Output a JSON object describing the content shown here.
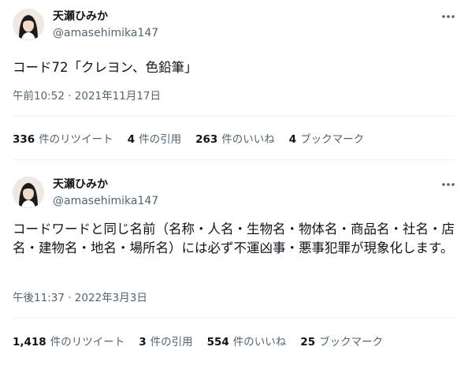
{
  "tweets": [
    {
      "author": {
        "name": "天瀬ひみか",
        "handle": "@amasehimika147"
      },
      "text": "コード72「クレヨン、色鉛筆」",
      "timestamp": "午前10:52 · 2021年11月17日",
      "stats": {
        "retweets": {
          "count": "336",
          "label": "件のリツイート"
        },
        "quotes": {
          "count": "4",
          "label": "件の引用"
        },
        "likes": {
          "count": "263",
          "label": "件のいいね"
        },
        "bookmarks": {
          "count": "4",
          "label": "ブックマーク"
        }
      }
    },
    {
      "author": {
        "name": "天瀬ひみか",
        "handle": "@amasehimika147"
      },
      "text": "コードワードと同じ名前（名称・人名・生物名・物体名・商品名・社名・店名・建物名・地名・場所名）には必ず不運凶事・悪事犯罪が現象化します。",
      "timestamp": "午後11:37 · 2022年3月3日",
      "stats": {
        "retweets": {
          "count": "1,418",
          "label": "件のリツイート"
        },
        "quotes": {
          "count": "3",
          "label": "件の引用"
        },
        "likes": {
          "count": "554",
          "label": "件のいいね"
        },
        "bookmarks": {
          "count": "25",
          "label": "ブックマーク"
        }
      }
    }
  ],
  "icons": {
    "more": "more-horizontal-icon",
    "avatar": "profile-photo"
  }
}
